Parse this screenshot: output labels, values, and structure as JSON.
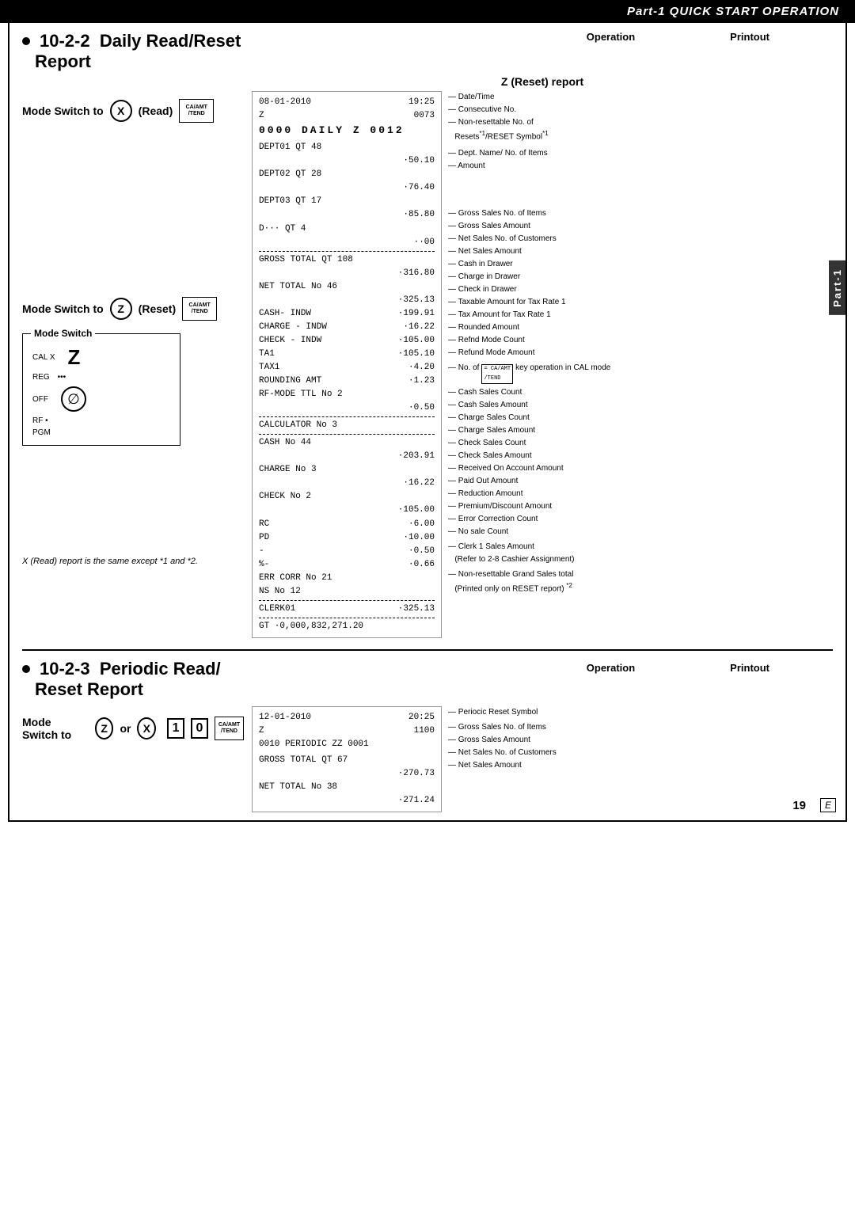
{
  "header": {
    "title": "Part-1  QUICK START OPERATION"
  },
  "section1": {
    "number": "10-2-2",
    "title": "Daily Read/Reset",
    "subtitle": "Report",
    "mode_read": {
      "label": "Mode Switch to",
      "letter": "X",
      "paren": "(Read)"
    },
    "mode_reset": {
      "label": "Mode Switch to",
      "letter": "Z",
      "paren": "(Reset)"
    },
    "mode_switch_title": "Mode Switch",
    "mode_switch_items": [
      {
        "label": "CAL X",
        "extra": "Z"
      },
      {
        "label": "REG",
        "dots": "..."
      },
      {
        "label": "OFF"
      },
      {
        "label": "RF"
      },
      {
        "label": "PGM"
      }
    ],
    "op_label": "Operation",
    "print_label": "Printout",
    "z_report_title": "Z (Reset) report",
    "printout": {
      "date": "08-01-2010",
      "time": "19:25",
      "z": "Z",
      "consec_no": "0073",
      "daily_line": "0000 DAILY   Z 0012",
      "dept01": "DEPT01       QT    48",
      "dept01_amt": "·50.10",
      "dept02": "DEPT02       QT    28",
      "dept02_amt": "·76.40",
      "dept03": "DEPT03       QT    17",
      "dept03_amt": "·85.80",
      "dept_etc": "D···         QT     4",
      "dept_etc_amt": "··00",
      "dashed1": "----------------------",
      "gross_total": "GROSS TOTAL  QT   108",
      "gross_total_amt": "·316.80",
      "net_total": "NET TOTAL    No    46",
      "net_total_amt": "·325.13",
      "cash_indw": "CASH- INDW",
      "cash_indw_amt": "·199.91",
      "charge_indw": "CHARGE - INDW",
      "charge_indw_amt": "·16.22",
      "check_indw": "CHECK - INDW",
      "check_indw_amt": "·105.00",
      "ta1": "TA1",
      "ta1_amt": "·105.10",
      "tax1": "TAX1",
      "tax1_amt": "·4.20",
      "rounding": "ROUNDING AMT",
      "rounding_amt": "·1.23",
      "rf_mode": "RF-MODE TTL  No     2",
      "rf_mode_amt": "·0.50",
      "dashed2": "----------------------",
      "calculator": "CALCULATOR   No     3",
      "dashed3": "----------------------",
      "cash": "CASH         No    44",
      "cash_amt": "·203.91",
      "charge": "CHARGE       No     3",
      "charge_amt": "·16.22",
      "check": "CHECK        No     2",
      "check_amt": "·105.00",
      "rc": "RC",
      "rc_amt": "·6.00",
      "pd": "PD",
      "pd_amt": "·10.00",
      "reduction": "-",
      "reduction_amt": "·0.50",
      "pct_minus": "%-",
      "pct_minus_amt": "·0.66",
      "err_corr": "ERR CORR     No    21",
      "ns": "NS           No    12",
      "dashed4": "----------------------",
      "clerk01": "CLERK01",
      "clerk01_amt": "·325.13",
      "dashed5": "----------------------",
      "gt": "GT     ·0,000,832,271.20"
    },
    "annotations": {
      "date_time": "Date/Time",
      "consec_no": "Consecutive No.",
      "non_resettable": "Non-resettable No. of",
      "resets": "Resets",
      "reset_symbol": "/RESET Symbol",
      "sup1": "*1",
      "sup2": "*1",
      "dept_name": "Dept. Name/ No. of Items",
      "amount": "Amount",
      "gross_sales_items": "Gross Sales No. of Items",
      "gross_sales_amount": "Gross Sales Amount",
      "net_sales_customers": "Net Sales No. of Customers",
      "net_sales_amount": "Net Sales Amount",
      "cash_in_drawer": "Cash in Drawer",
      "charge_in_drawer": "Charge in Drawer",
      "check_in_drawer": "Check in Drawer",
      "taxable_amount": "Taxable Amount for Tax Rate 1",
      "tax_amount": "Tax Amount for Tax Rate 1",
      "rounded_amount": "Rounded Amount",
      "refnd_mode_count": "Refnd Mode Count",
      "refund_mode_amount": "Refund Mode Amount",
      "cal_mode_note": "No. of",
      "cal_key_note": "key operation in CAL mode",
      "cash_sales_count": "Cash Sales Count",
      "cash_sales_amount": "Cash Sales Amount",
      "charge_sales_count": "Charge Sales Count",
      "charge_sales_amount": "Charge Sales Amount",
      "check_sales_count": "Check Sales Count",
      "check_sales_amount": "Check Sales Amount",
      "received_on_account": "Received On Account Amount",
      "paid_out": "Paid Out Amount",
      "reduction": "Reduction Amount",
      "premium_discount": "Premium/Discount Amount",
      "error_correction": "Error Correction Count",
      "no_sale_count": "No sale Count",
      "clerk1_sales": "Clerk 1 Sales Amount",
      "refer_to": "(Refer to 2-8 Cashier Assignment)",
      "non_resettable_grand": "Non-resettable Grand Sales total",
      "printed_only": "(Printed only on RESET report)",
      "sup_2": "*2"
    },
    "footnote": "X (Read) report is the same except *1 and *2."
  },
  "section2": {
    "number": "10-2-3",
    "title": "Periodic Read/",
    "subtitle": "Reset Report",
    "mode_label": "Mode Switch to",
    "letter1": "Z",
    "or_text": "or",
    "letter2": "X",
    "op_label": "Operation",
    "print_label": "Printout",
    "key_1": "1",
    "key_0": "0",
    "key_equals": "CA/AMT /TEND",
    "printout": {
      "date": "12-01-2010",
      "time": "20:25",
      "z": "Z",
      "z_no": "1100",
      "periodic_line": "0010 PERIODIC  ZZ 0001",
      "gross_total": "GROSS TOTAL   QT    67",
      "gross_total_amt": "·270.73",
      "net_total": "NET TOTAL     No    38",
      "net_total_amt": "·271.24"
    },
    "annotations": {
      "periodic_reset": "Periocic Reset Symbol",
      "gross_sales_items": "Gross Sales No. of Items",
      "gross_sales_amount": "Gross Sales Amount",
      "net_sales_customers": "Net Sales No. of Customers",
      "net_sales_amount": "Net Sales Amount"
    }
  },
  "part_label": "Part-1",
  "page_number": "19",
  "e_label": "E"
}
